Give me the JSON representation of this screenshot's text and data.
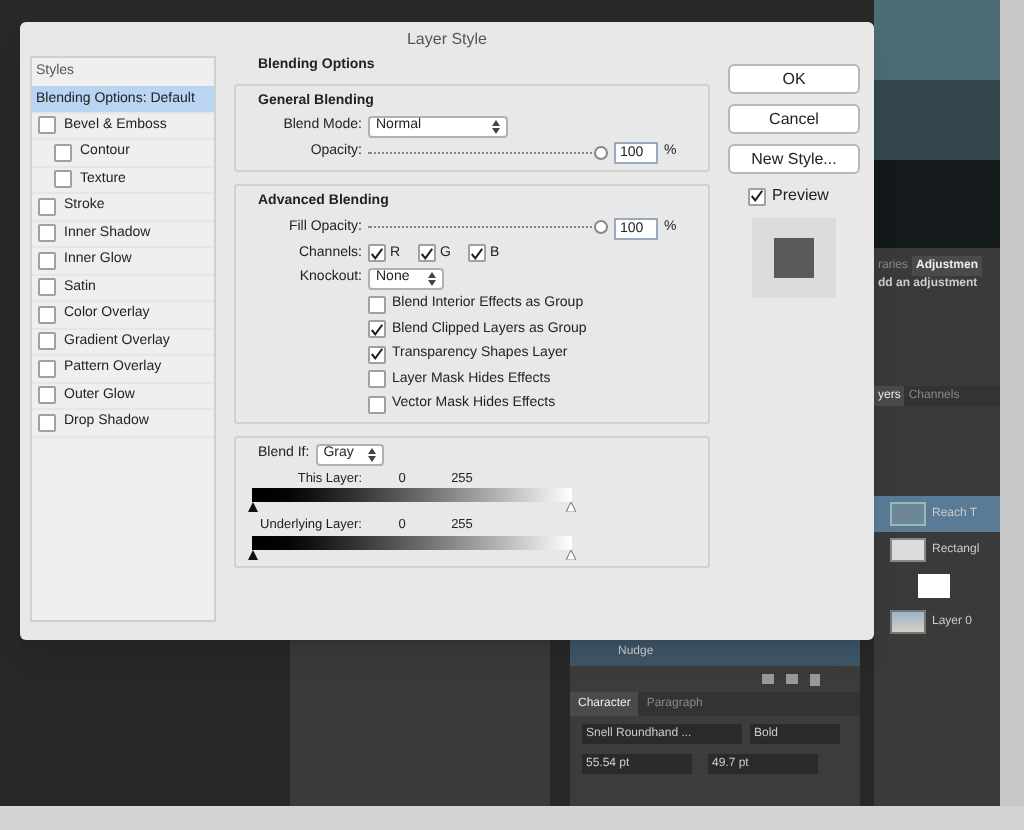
{
  "dialog": {
    "title": "Layer Style",
    "styles_header": "Styles",
    "styles": [
      {
        "label": "Blending Options: Default",
        "kind": "header",
        "selected": true
      },
      {
        "label": "Bevel & Emboss",
        "kind": "check",
        "checked": false,
        "selected": false,
        "children": [
          {
            "label": "Contour",
            "checked": false
          },
          {
            "label": "Texture",
            "checked": false
          }
        ]
      },
      {
        "label": "Stroke",
        "kind": "check",
        "checked": false,
        "selected": false
      },
      {
        "label": "Inner Shadow",
        "kind": "check",
        "checked": false,
        "selected": false
      },
      {
        "label": "Inner Glow",
        "kind": "check",
        "checked": false,
        "selected": false
      },
      {
        "label": "Satin",
        "kind": "check",
        "checked": false,
        "selected": false
      },
      {
        "label": "Color Overlay",
        "kind": "check",
        "checked": false,
        "selected": false
      },
      {
        "label": "Gradient Overlay",
        "kind": "check",
        "checked": false,
        "selected": false
      },
      {
        "label": "Pattern Overlay",
        "kind": "check",
        "checked": false,
        "selected": false
      },
      {
        "label": "Outer Glow",
        "kind": "check",
        "checked": false,
        "selected": false
      },
      {
        "label": "Drop Shadow",
        "kind": "check",
        "checked": false,
        "selected": false
      }
    ],
    "blending": {
      "title": "Blending Options",
      "general_title": "General Blending",
      "blend_mode_label": "Blend Mode:",
      "blend_mode": "Normal",
      "opacity_label": "Opacity:",
      "opacity": {
        "level": 1
      },
      "opacity_value": "100",
      "opacity_unit": "%",
      "advanced_title": "Advanced Blending",
      "fill_label": "Fill Opacity:",
      "fill": {
        "level": 1
      },
      "fill_value": "100",
      "fill_unit": "%",
      "channels_label": "Channels:",
      "channels": [
        {
          "label": "R",
          "checked": true
        },
        {
          "label": "G",
          "checked": true
        },
        {
          "label": "B",
          "checked": true
        }
      ],
      "knockout_label": "Knockout:",
      "knockout": "None",
      "options": [
        {
          "label": "Blend Interior Effects as Group",
          "checked": false
        },
        {
          "label": "Blend Clipped Layers as Group",
          "checked": true
        },
        {
          "label": "Transparency Shapes Layer",
          "checked": true
        },
        {
          "label": "Layer Mask Hides Effects",
          "checked": false
        },
        {
          "label": "Vector Mask Hides Effects",
          "checked": false
        }
      ]
    },
    "blend_if": {
      "label": "Blend If:",
      "value": "Gray",
      "layers": [
        {
          "label": "This Layer:",
          "low": "0",
          "high": "255"
        },
        {
          "label": "Underlying Layer:",
          "low": "0",
          "high": "255"
        }
      ]
    },
    "buttons": [
      "OK",
      "Cancel",
      "New Style..."
    ],
    "preview": {
      "label": "Preview",
      "checked": true
    }
  },
  "right_panel": {
    "tabs": [
      {
        "label": "raries",
        "selected": false
      },
      {
        "label": "Adjustmen",
        "selected": true
      }
    ],
    "hint": "dd an adjustment",
    "layer_tabs": [
      {
        "label": "yers",
        "selected": true
      },
      {
        "label": "Channels",
        "selected": false
      }
    ],
    "layers": [
      {
        "label": "Reach T",
        "kind": "text",
        "selected": true
      },
      {
        "label": "Rectangl",
        "kind": "shape",
        "selected": false
      },
      {
        "kind": "mask",
        "selected": false
      },
      {
        "label": "Layer 0",
        "selected": false
      }
    ]
  },
  "bottom_panel": {
    "row_label": "Nudge",
    "tabs": [
      {
        "label": "Character",
        "selected": true
      },
      {
        "label": "Paragraph",
        "selected": false
      }
    ],
    "font": "Snell Roundhand ...",
    "style": "Bold",
    "size": "55.54 pt",
    "leading": "49.7 pt"
  }
}
